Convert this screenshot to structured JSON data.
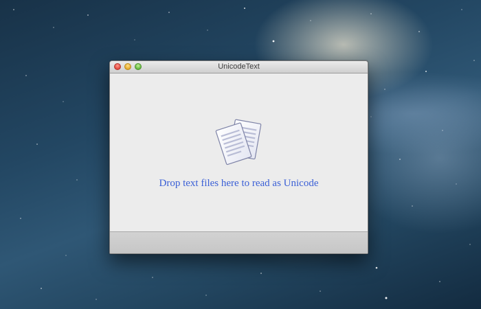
{
  "window": {
    "title": "UnicodeText",
    "controls": [
      "close",
      "minimize",
      "zoom"
    ]
  },
  "dropzone": {
    "icon": "documents-icon",
    "message": "Drop text files here to read as Unicode",
    "message_color": "#3a5fd6"
  }
}
